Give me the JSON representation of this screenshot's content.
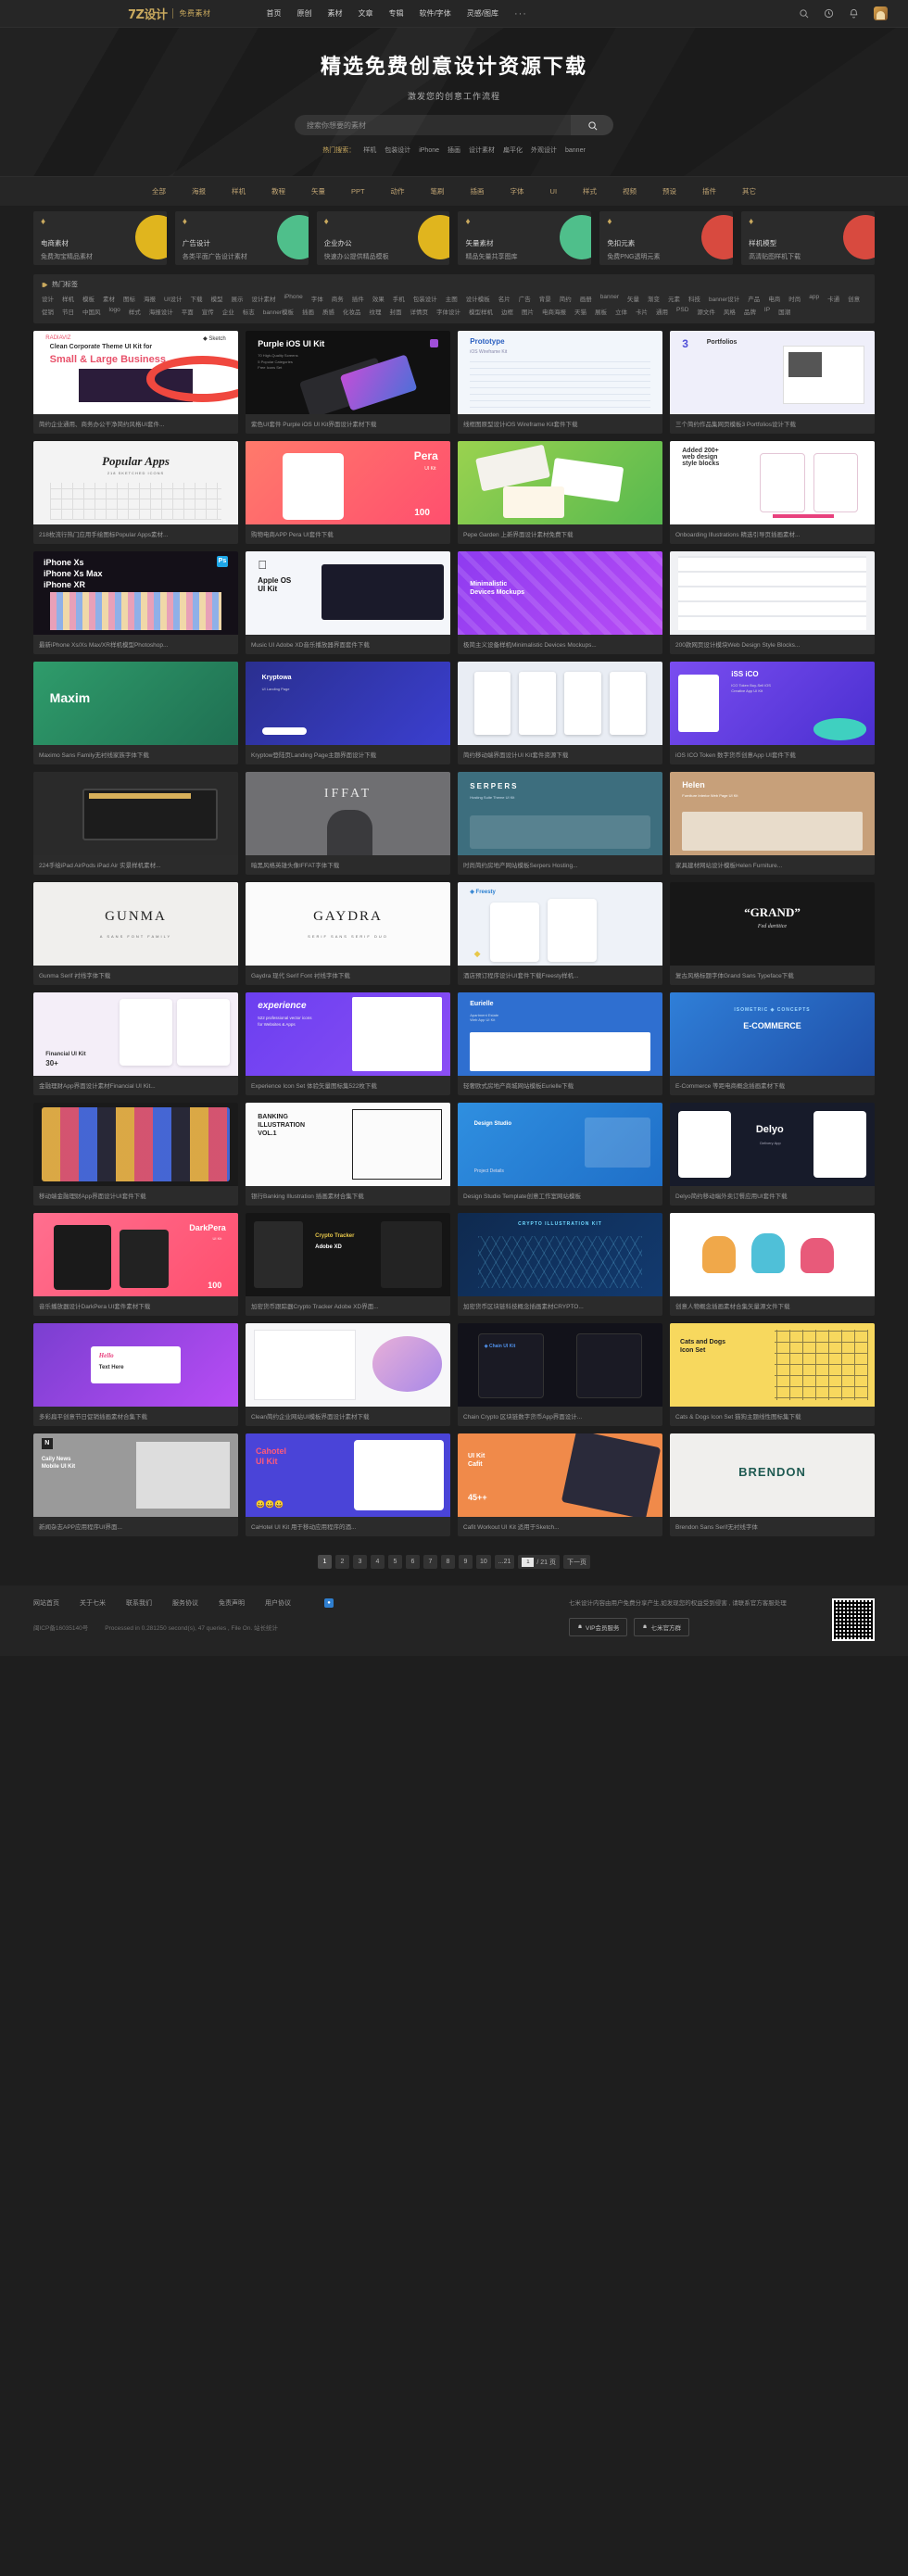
{
  "header": {
    "logo_mark": "7Z设计",
    "logo_sub": "免费素材",
    "nav": [
      {
        "label": "首页"
      },
      {
        "label": "原创"
      },
      {
        "label": "素材"
      },
      {
        "label": "文章"
      },
      {
        "label": "专辑"
      },
      {
        "label": "软件/字体"
      },
      {
        "label": "灵感/图库"
      },
      {
        "label": "···"
      }
    ],
    "icons": [
      "search-icon",
      "compass-icon",
      "bell-icon",
      "avatar"
    ]
  },
  "hero": {
    "title": "精选免费创意设计资源下载",
    "subtitle": "激发您的创意工作流程",
    "search_placeholder": "搜索你想要的素材",
    "search_value": "",
    "hot_label": "热门搜索：",
    "hot_tags": [
      "样机",
      "包装设计",
      "iPhone",
      "插画",
      "设计素材",
      "扁平化",
      "外观设计",
      "banner"
    ]
  },
  "categories": [
    "全部",
    "海报",
    "样机",
    "教程",
    "矢量",
    "PPT",
    "动作",
    "笔刷",
    "插画",
    "字体",
    "UI",
    "样式",
    "视频",
    "预设",
    "插件",
    "其它"
  ],
  "banners": [
    {
      "title": "电商素材",
      "sub": "免费淘宝精品素材",
      "color": "#e0b51e"
    },
    {
      "title": "广告设计",
      "sub": "各类平面广告设计素材",
      "color": "#4fbf8b"
    },
    {
      "title": "企业办公",
      "sub": "快速办公提供精品模板",
      "color": "#e0b51e"
    },
    {
      "title": "矢量素材",
      "sub": "精品矢量共享图库",
      "color": "#4fbf8b"
    },
    {
      "title": "免扣元素",
      "sub": "免费PNG透明元素",
      "color": "#d84a3f"
    },
    {
      "title": "样机模型",
      "sub": "高清贴图样机下载",
      "color": "#d84a3f"
    }
  ],
  "tagbox": {
    "heading": "热门标签",
    "tags": [
      "设计",
      "样机",
      "模板",
      "素材",
      "图标",
      "海报",
      "UI设计",
      "下载",
      "模型",
      "展示",
      "设计素材",
      "iPhone",
      "字体",
      "商务",
      "插件",
      "效果",
      "手机",
      "包装设计",
      "主图",
      "设计模板",
      "名片",
      "广告",
      "背景",
      "简约",
      "画册",
      "banner",
      "矢量",
      "渐变",
      "元素",
      "科技",
      "banner设计",
      "产品",
      "电商",
      "时尚",
      "app",
      "卡通",
      "创意",
      "促销",
      "节日",
      "中国风",
      "logo",
      "样式",
      "海报设计",
      "平面",
      "宣传",
      "企业",
      "标志",
      "banner模板",
      "插画",
      "质感",
      "化妆品",
      "纹理",
      "封面",
      "详情页",
      "字体设计",
      "模型样机",
      "边框",
      "图片",
      "电商海报",
      "天猫",
      "展板",
      "立体",
      "卡片",
      "通用",
      "PSD",
      "源文件",
      "风格",
      "品牌",
      "IP",
      "国潮"
    ]
  },
  "cards": [
    {
      "caption": "简约企业通用、商务办公干净简约风格UI套件...",
      "theme": "radiaviz"
    },
    {
      "caption": "紫色UI套件 Purple iOS UI Kit界面设计素材下载",
      "theme": "purpleios"
    },
    {
      "caption": "线框图原型设计iOS Wireframe Kit套件下载",
      "theme": "prototype"
    },
    {
      "caption": "三个简约作品集网页模板3 Portfolios设计下载",
      "theme": "portfolios"
    },
    {
      "caption": "218枚流行热门应用手绘图标Popular Apps素材...",
      "theme": "popularapps"
    },
    {
      "caption": "购物电商APP Pera UI套件下载",
      "theme": "pera"
    },
    {
      "caption": "Pepe Garden 上新界面设计素材免费下载",
      "theme": "pepegarden"
    },
    {
      "caption": "Onboarding Illustrations 精选引导页插画素材...",
      "theme": "onboarding"
    },
    {
      "caption": "最新iPhone Xs/Xs Max/XR样机模型Photoshop...",
      "theme": "iphonexs"
    },
    {
      "caption": "Music UI Adobe XD音乐播放器界面套件下载",
      "theme": "applekit"
    },
    {
      "caption": "极简主义设备样机Minimalistic Devices Mockups...",
      "theme": "minimalistic"
    },
    {
      "caption": "200款网页设计模块Web Design Style Blocks...",
      "theme": "styleblocks"
    },
    {
      "caption": "Maximo Sans Family无衬线家族字体下载",
      "theme": "maxim"
    },
    {
      "caption": "Kryptow登陆页Landing Page主题界面设计下载",
      "theme": "kryptowa"
    },
    {
      "caption": "简约移动端界面设计UI Kit套件资源下载",
      "theme": "mobilekit"
    },
    {
      "caption": "iOS ICO Token 数字货币创意App UI套件下载",
      "theme": "issico"
    },
    {
      "caption": "224手绘iPad AirPods iPad Air 实景样机素材...",
      "theme": "ipadhand"
    },
    {
      "caption": "暗黑风格英雄头像IFFAT字体下载",
      "theme": "iffat"
    },
    {
      "caption": "时尚简约房地产网站模板Serpers Hosting...",
      "theme": "serpers"
    },
    {
      "caption": "家具建材网站设计模板Helen Furniture...",
      "theme": "helen"
    },
    {
      "caption": "Gunma Serif 衬线字体下载",
      "theme": "gunma"
    },
    {
      "caption": "Gaydra 现代 Serif Font 衬线字体下载",
      "theme": "gaydra"
    },
    {
      "caption": "酒店预订程序设计UI套件下载Freesty样机...",
      "theme": "freesty"
    },
    {
      "caption": "复古风格标题字体Grand Sans Typeface下载",
      "theme": "grand"
    },
    {
      "caption": "金融理财App界面设计素材Financial UI Kit...",
      "theme": "financial"
    },
    {
      "caption": "Experience Icon Set 体验矢量图标集522枚下载",
      "theme": "experience"
    },
    {
      "caption": "轻奢欧式房地产商城网站模板Eurielle下载",
      "theme": "eurielle"
    },
    {
      "caption": "E-Commerce 等距电商概念插画素材下载",
      "theme": "isometric"
    },
    {
      "caption": "移动端金融理财App界面设计UI套件下载",
      "theme": "financeapp"
    },
    {
      "caption": "银行Banking Illustration 插画素材合集下载",
      "theme": "banking"
    },
    {
      "caption": "Design Studio Template创意工作室网站模板",
      "theme": "projectdetails"
    },
    {
      "caption": "Delyo简约移动端外卖订餐应用UI套件下载",
      "theme": "delyo"
    },
    {
      "caption": "音乐播放器设计DarkPera UI套件素材下载",
      "theme": "darkpera"
    },
    {
      "caption": "加密货币跟踪器Crypto Tracker Adobe XD界面...",
      "theme": "cryptotracker"
    },
    {
      "caption": "加密货币区块链科技概念插画素材CRYPTO...",
      "theme": "cryptoillus"
    },
    {
      "caption": "创意人物概念插画素材合集矢量源文件下载",
      "theme": "charillus"
    },
    {
      "caption": "多彩扁平创意节日促销插画素材合集下载",
      "theme": "hellotext"
    },
    {
      "caption": "Clean简约企业网站UI模板界面设计素材下载",
      "theme": "cleanux"
    },
    {
      "caption": "Chain Crypto 区块链数字货币App界面设计...",
      "theme": "chaincrypto"
    },
    {
      "caption": "Cats & Dogs Icon Set 猫狗主题线性图标集下载",
      "theme": "catsdogs"
    },
    {
      "caption": "新闻杂志APP应用程序UI界面...",
      "theme": "cailynews"
    },
    {
      "caption": "CaHotel UI Kit 用于移动应用程序的酒...",
      "theme": "cahotel"
    },
    {
      "caption": "Cafit Workout UI Kit 适用于Sketch...",
      "theme": "cafit"
    },
    {
      "caption": "Brendon Sans Serif无衬线字体",
      "theme": "brendon"
    }
  ],
  "pagination": {
    "pages": [
      "1",
      "2",
      "3",
      "4",
      "5",
      "6",
      "7",
      "8",
      "9",
      "10",
      "...21"
    ],
    "current": "1",
    "input_value": "1",
    "total_label": "/ 21 页",
    "next_label": "下一页"
  },
  "footer": {
    "links": [
      "网站首页",
      "关于七米",
      "联系我们",
      "服务协议",
      "免责声明",
      "用户协议"
    ],
    "meta": [
      "闽ICP备16035140号",
      "Processed in 0.281250 second(s), 47 queries , File On. 站长统计"
    ],
    "note": "七米设计内容由用户免费分享产生,如发现您的权益受到侵害 , 请联系官方客服处理",
    "buttons": [
      "VIP会员服务",
      "七米官方群"
    ]
  }
}
